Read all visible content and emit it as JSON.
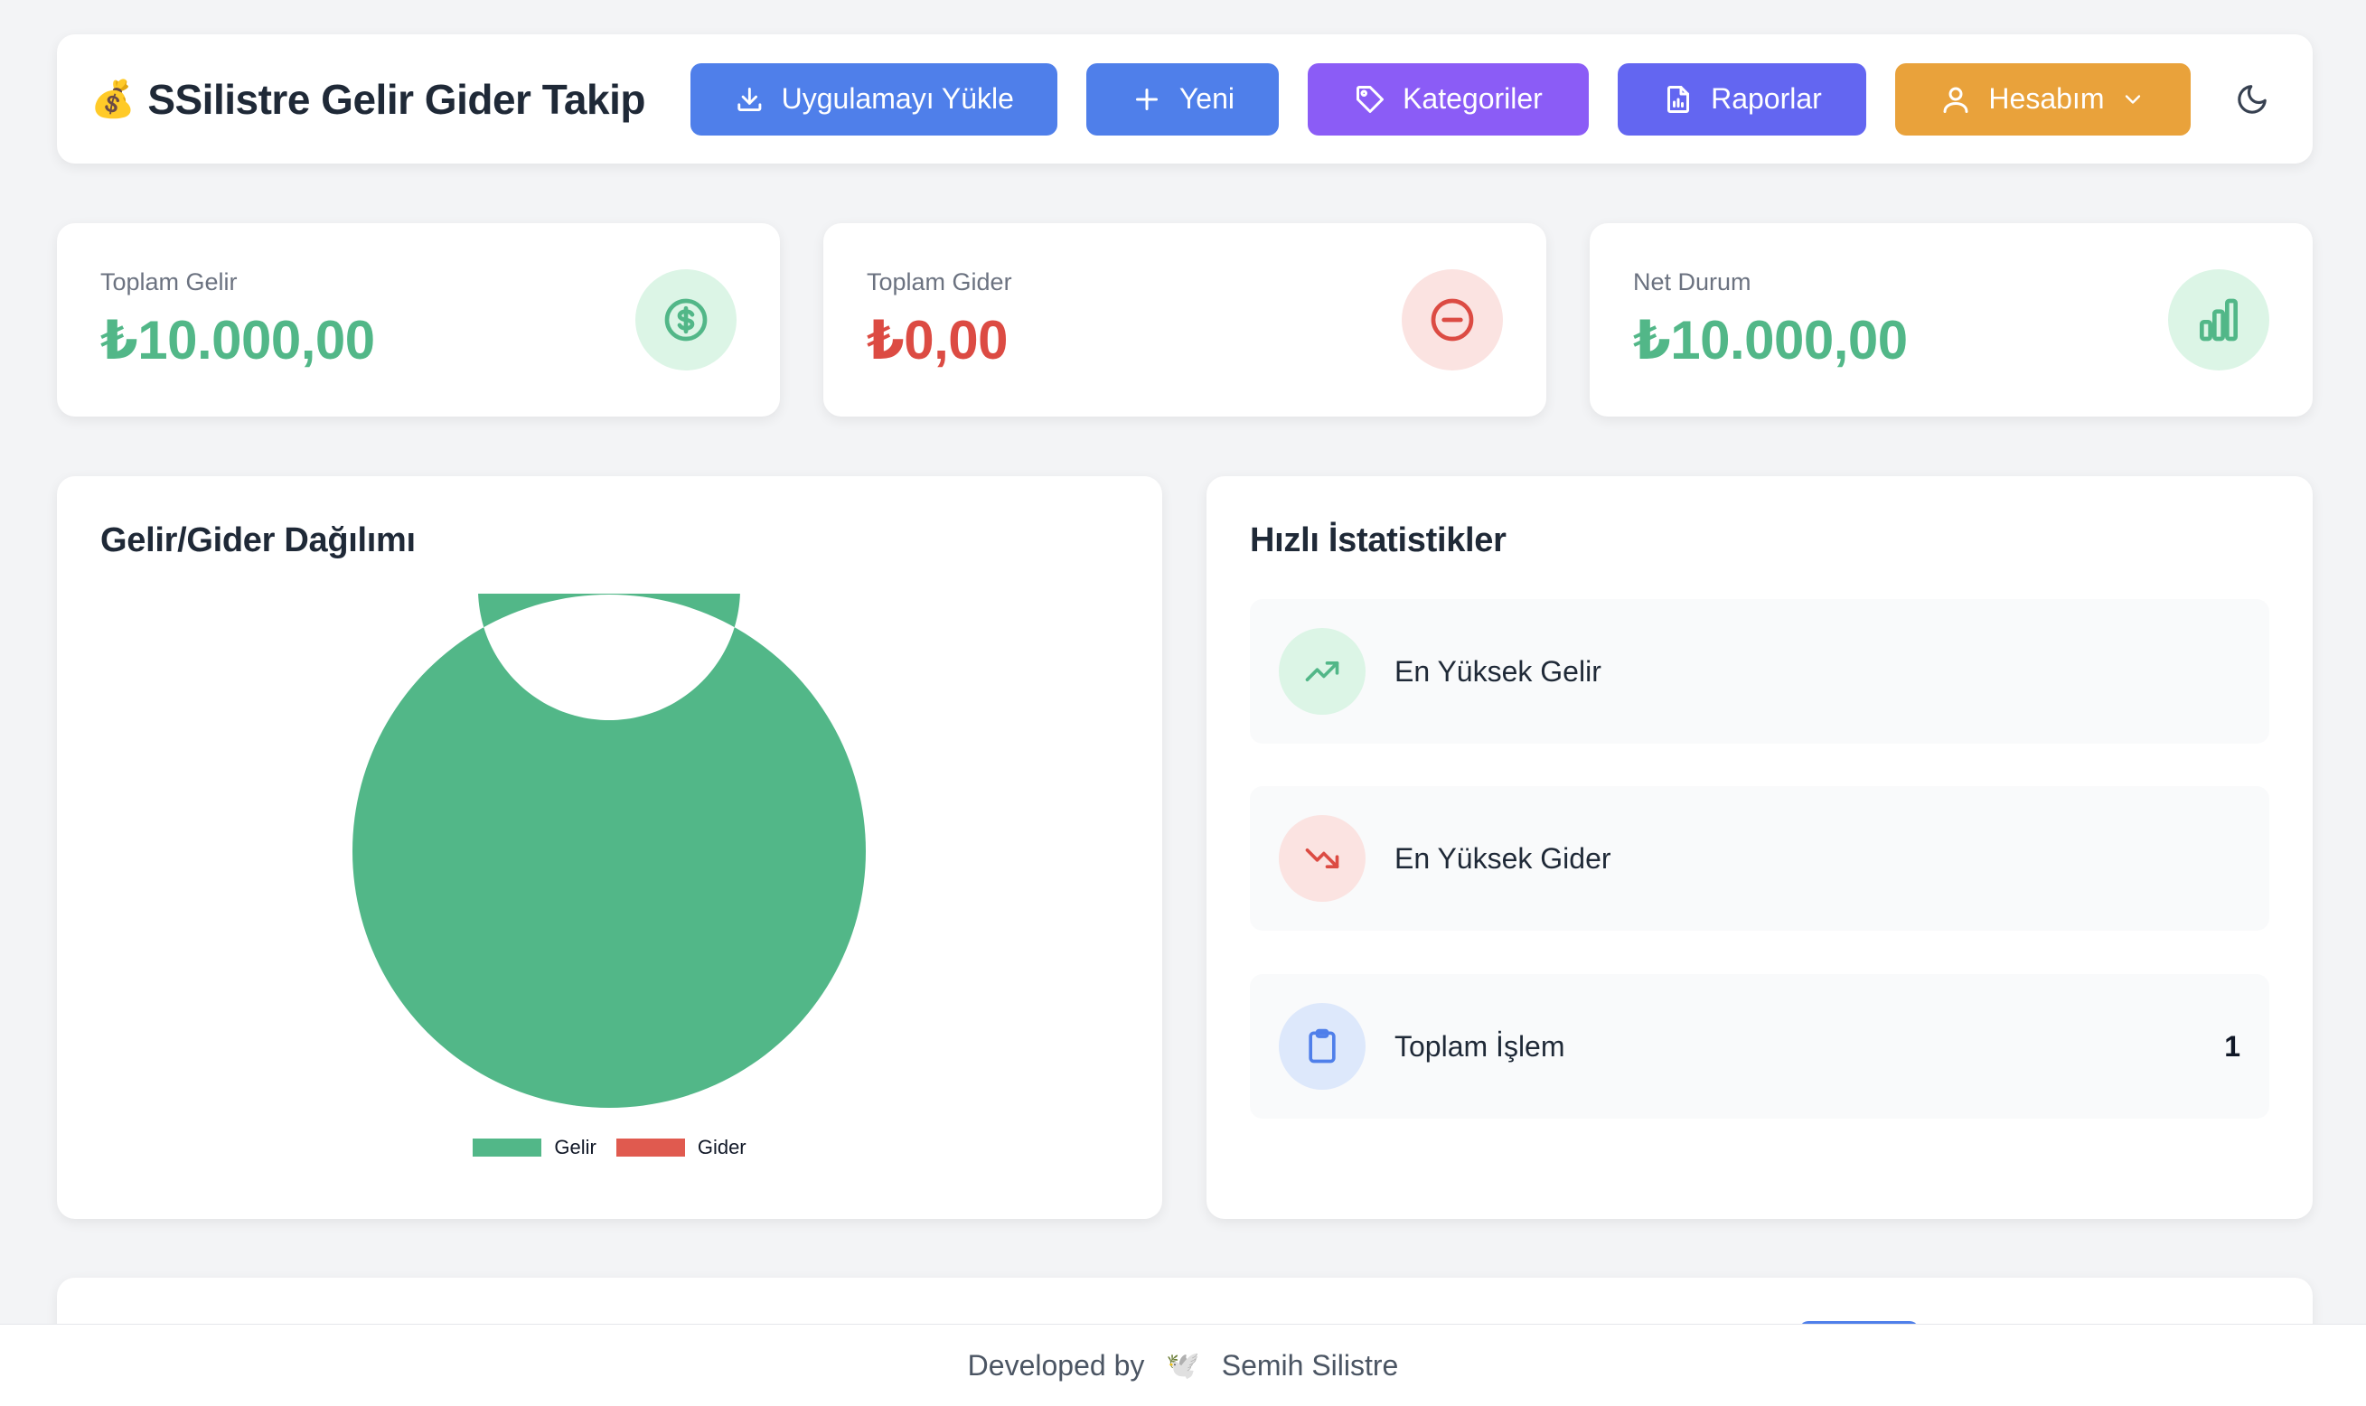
{
  "header": {
    "brand_emoji": "💰",
    "brand_title": "SSilistre Gelir Gider Takip",
    "buttons": {
      "install": "Uygulamayı Yükle",
      "new": "Yeni",
      "categories": "Kategoriler",
      "reports": "Raporlar",
      "account": "Hesabım"
    }
  },
  "stats": {
    "income": {
      "label": "Toplam Gelir",
      "value": "₺10.000,00"
    },
    "expense": {
      "label": "Toplam Gider",
      "value": "₺0,00"
    },
    "net": {
      "label": "Net Durum",
      "value": "₺10.000,00"
    }
  },
  "distribution": {
    "title": "Gelir/Gider Dağılımı"
  },
  "chart_data": {
    "type": "pie",
    "categories": [
      "Gelir",
      "Gider"
    ],
    "values": [
      10000,
      0
    ],
    "colors": [
      "#52b788",
      "#e05a4f"
    ],
    "legend_position": "bottom"
  },
  "quick_stats": {
    "title": "Hızlı İstatistikler",
    "rows": [
      {
        "label": "En Yüksek Gelir",
        "value": ""
      },
      {
        "label": "En Yüksek Gider",
        "value": ""
      },
      {
        "label": "Toplam İşlem",
        "value": "1"
      }
    ]
  },
  "footer": {
    "prefix": "Developed by",
    "emoji": "🕊️",
    "author": "Semih Silistre"
  },
  "colors": {
    "background": "#f3f4f6",
    "income_green": "#52b788",
    "expense_red": "#dc4b43",
    "blue": "#4f7fea",
    "purple": "#8b5cf6",
    "indigo": "#6366f1",
    "orange": "#e9a23b"
  }
}
